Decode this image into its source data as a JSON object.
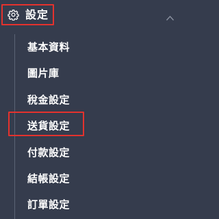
{
  "menu": {
    "title": "設定",
    "icon": "gear-icon",
    "toggle_icon": "chevron-up-icon",
    "expanded": true,
    "items": [
      {
        "label": "基本資料"
      },
      {
        "label": "圖片庫"
      },
      {
        "label": "稅金設定"
      },
      {
        "label": "送貨設定",
        "highlighted": true
      },
      {
        "label": "付款設定"
      },
      {
        "label": "結帳設定"
      },
      {
        "label": "訂單設定"
      }
    ]
  },
  "colors": {
    "background": "#353c4d",
    "text": "#ffffff",
    "highlight_border": "#e5322d",
    "tree_line": "#5b6374"
  }
}
